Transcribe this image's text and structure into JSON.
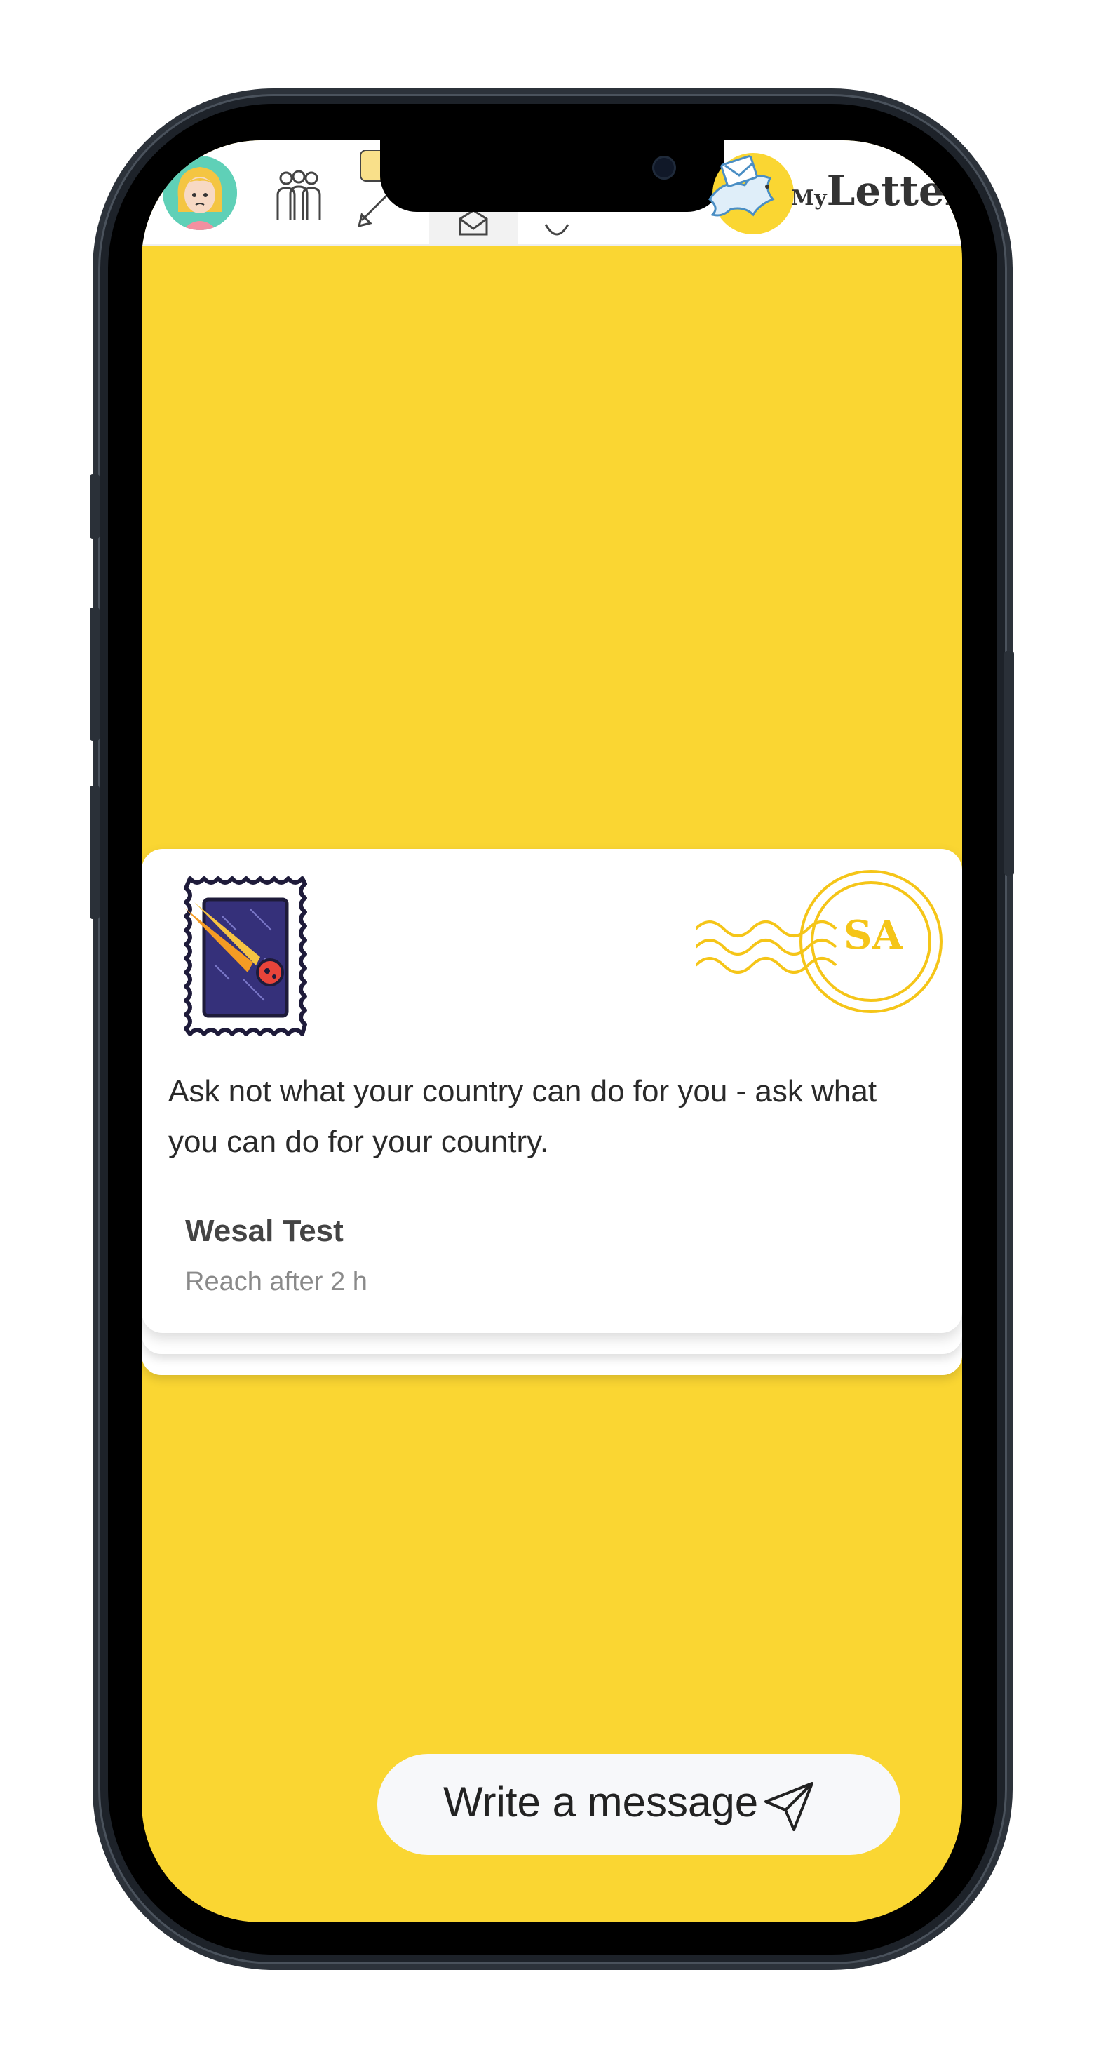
{
  "app": {
    "brand_prefix": "My",
    "brand_name": "Letter"
  },
  "nav": {
    "items": [
      {
        "icon": "user-avatar-icon"
      },
      {
        "icon": "friends-icon"
      },
      {
        "icon": "write-letter-icon"
      },
      {
        "icon": "envelope-icon",
        "active": true
      },
      {
        "icon": "settings-icon"
      }
    ]
  },
  "letter": {
    "stamp_icon": "comet-stamp-icon",
    "postmark_code": "SA",
    "message": "Ask not what your country can do for you - ask what you can do for your country.",
    "sender": "Wesal Test",
    "eta": "Reach after 2 h"
  },
  "compose": {
    "label": "Write a message",
    "icon": "send-icon"
  },
  "colors": {
    "background": "#FAD632",
    "card": "#FFFFFF",
    "postmark": "#F5C518",
    "stamp_frame": "#1E1B3A",
    "button": "#F7F8FA"
  }
}
